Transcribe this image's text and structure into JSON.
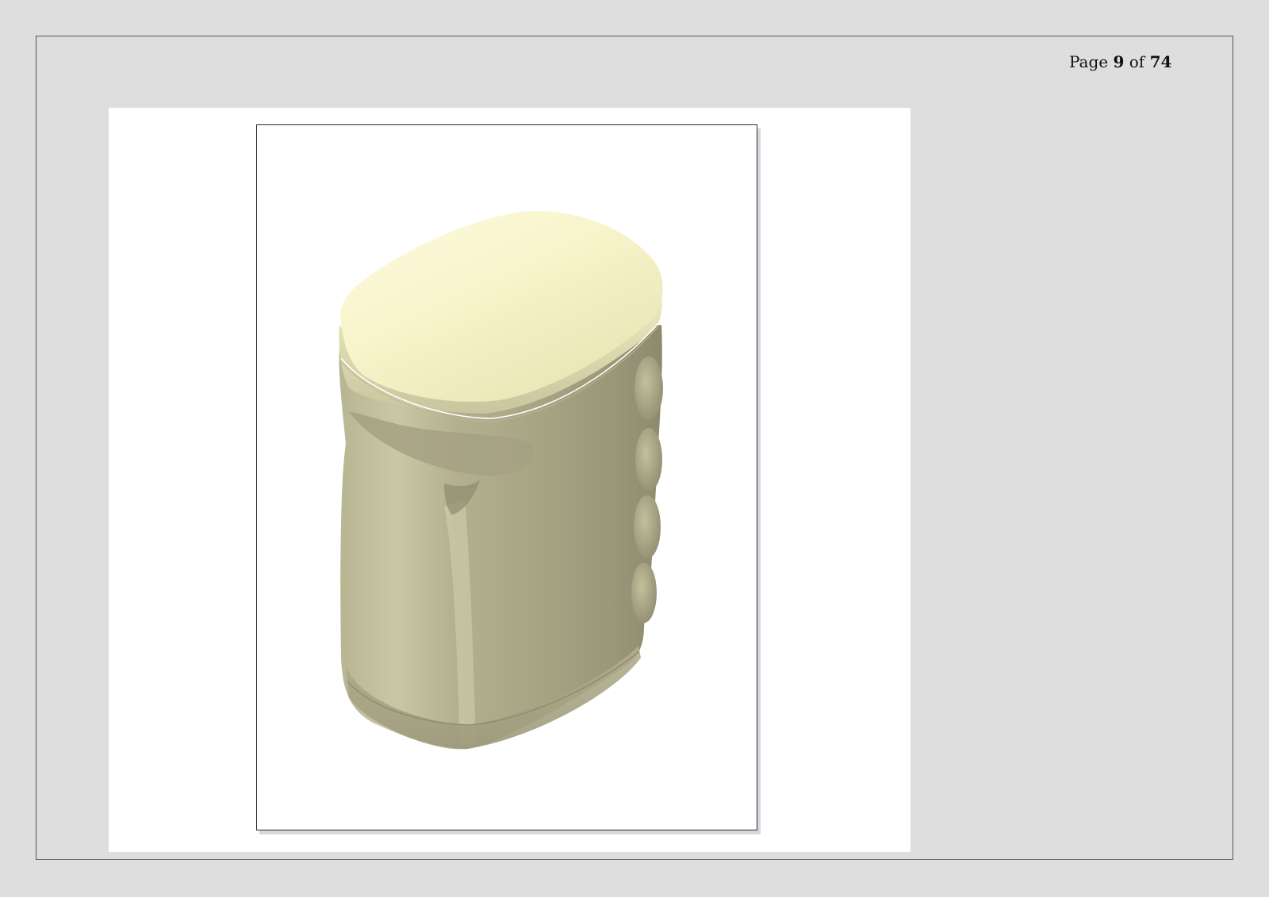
{
  "pagination": {
    "prefix": "Page",
    "current": "9",
    "separator": "of",
    "total": "74"
  },
  "figure": {
    "colors": {
      "cap_light": "#fbf8d2",
      "cap_mid": "#e8e4b0",
      "body_light": "#c4c29d",
      "body_mid": "#a9a685",
      "body_dark": "#7f7d63",
      "edge_line": "#ffffff"
    }
  }
}
